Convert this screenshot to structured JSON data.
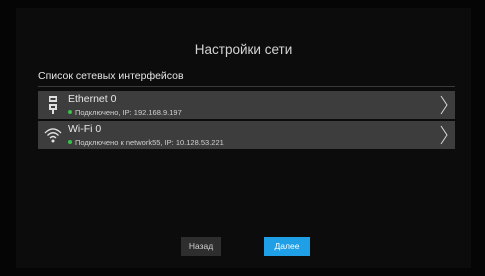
{
  "header": {
    "title": "Настройки сети"
  },
  "section": {
    "label": "Список сетевых интерфейсов"
  },
  "interfaces": [
    {
      "name": "Ethernet 0",
      "status": "Подключено, IP: 192.168.9.197",
      "icon": "ethernet-icon"
    },
    {
      "name": "Wi-Fi 0",
      "status": "Подключено к network55, IP: 10.128.53.221",
      "icon": "wifi-icon"
    }
  ],
  "buttons": {
    "back_label": "Назад",
    "next_label": "Далее"
  },
  "colors": {
    "accent": "#1f9fe6",
    "status_connected": "#39c24a",
    "row_background": "#3d3d3d"
  }
}
